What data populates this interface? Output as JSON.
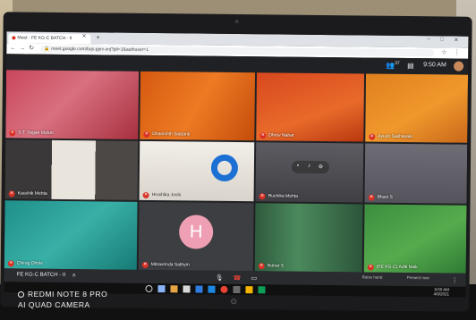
{
  "browser": {
    "tab_title": "Meet - FE KG-C BATCH - II",
    "new_tab_symbol": "+",
    "url": "meet.google.com/bqs-pjev-xnj?pli=1&authuser=1",
    "window_controls": [
      "–",
      "□",
      "✕"
    ]
  },
  "meet": {
    "top_bar": {
      "participant_count": "37",
      "time": "9:50 AM"
    },
    "tiles": [
      {
        "name": "S.T. Yagan Mutun"
      },
      {
        "name": "Dhanishth Siddanti"
      },
      {
        "name": "Dhruv Nahar"
      },
      {
        "name": "Ayush Sakhavale"
      },
      {
        "name": "Kaushik Mehta"
      },
      {
        "name": "Hrushika Joshi"
      },
      {
        "name": "Ruchika Mehta"
      },
      {
        "name": "Bhavi S"
      },
      {
        "name": "Chirag Dhole"
      },
      {
        "name": "Mitravrinda Sathym",
        "avatar_letter": "H"
      },
      {
        "name": "Nuhar S"
      },
      {
        "name": "(FE KG-C) Aditi Naik"
      }
    ],
    "bottom_bar": {
      "meeting_title": "FE KG-C BATCH - II",
      "side_buttons": [
        "Raise hand",
        "Present now"
      ]
    }
  },
  "taskbar": {
    "time": "9:50 AM",
    "date": "4/9/2021"
  },
  "watermark": {
    "line1": "REDMI NOTE 8 PRO",
    "line2": "AI QUAD CAMERA"
  },
  "colors": {
    "meet_background": "#202124",
    "mic_muted_red": "#d93025",
    "avatar_pink": "#ef9fb4",
    "ring_blue": "#1c6fd3"
  }
}
